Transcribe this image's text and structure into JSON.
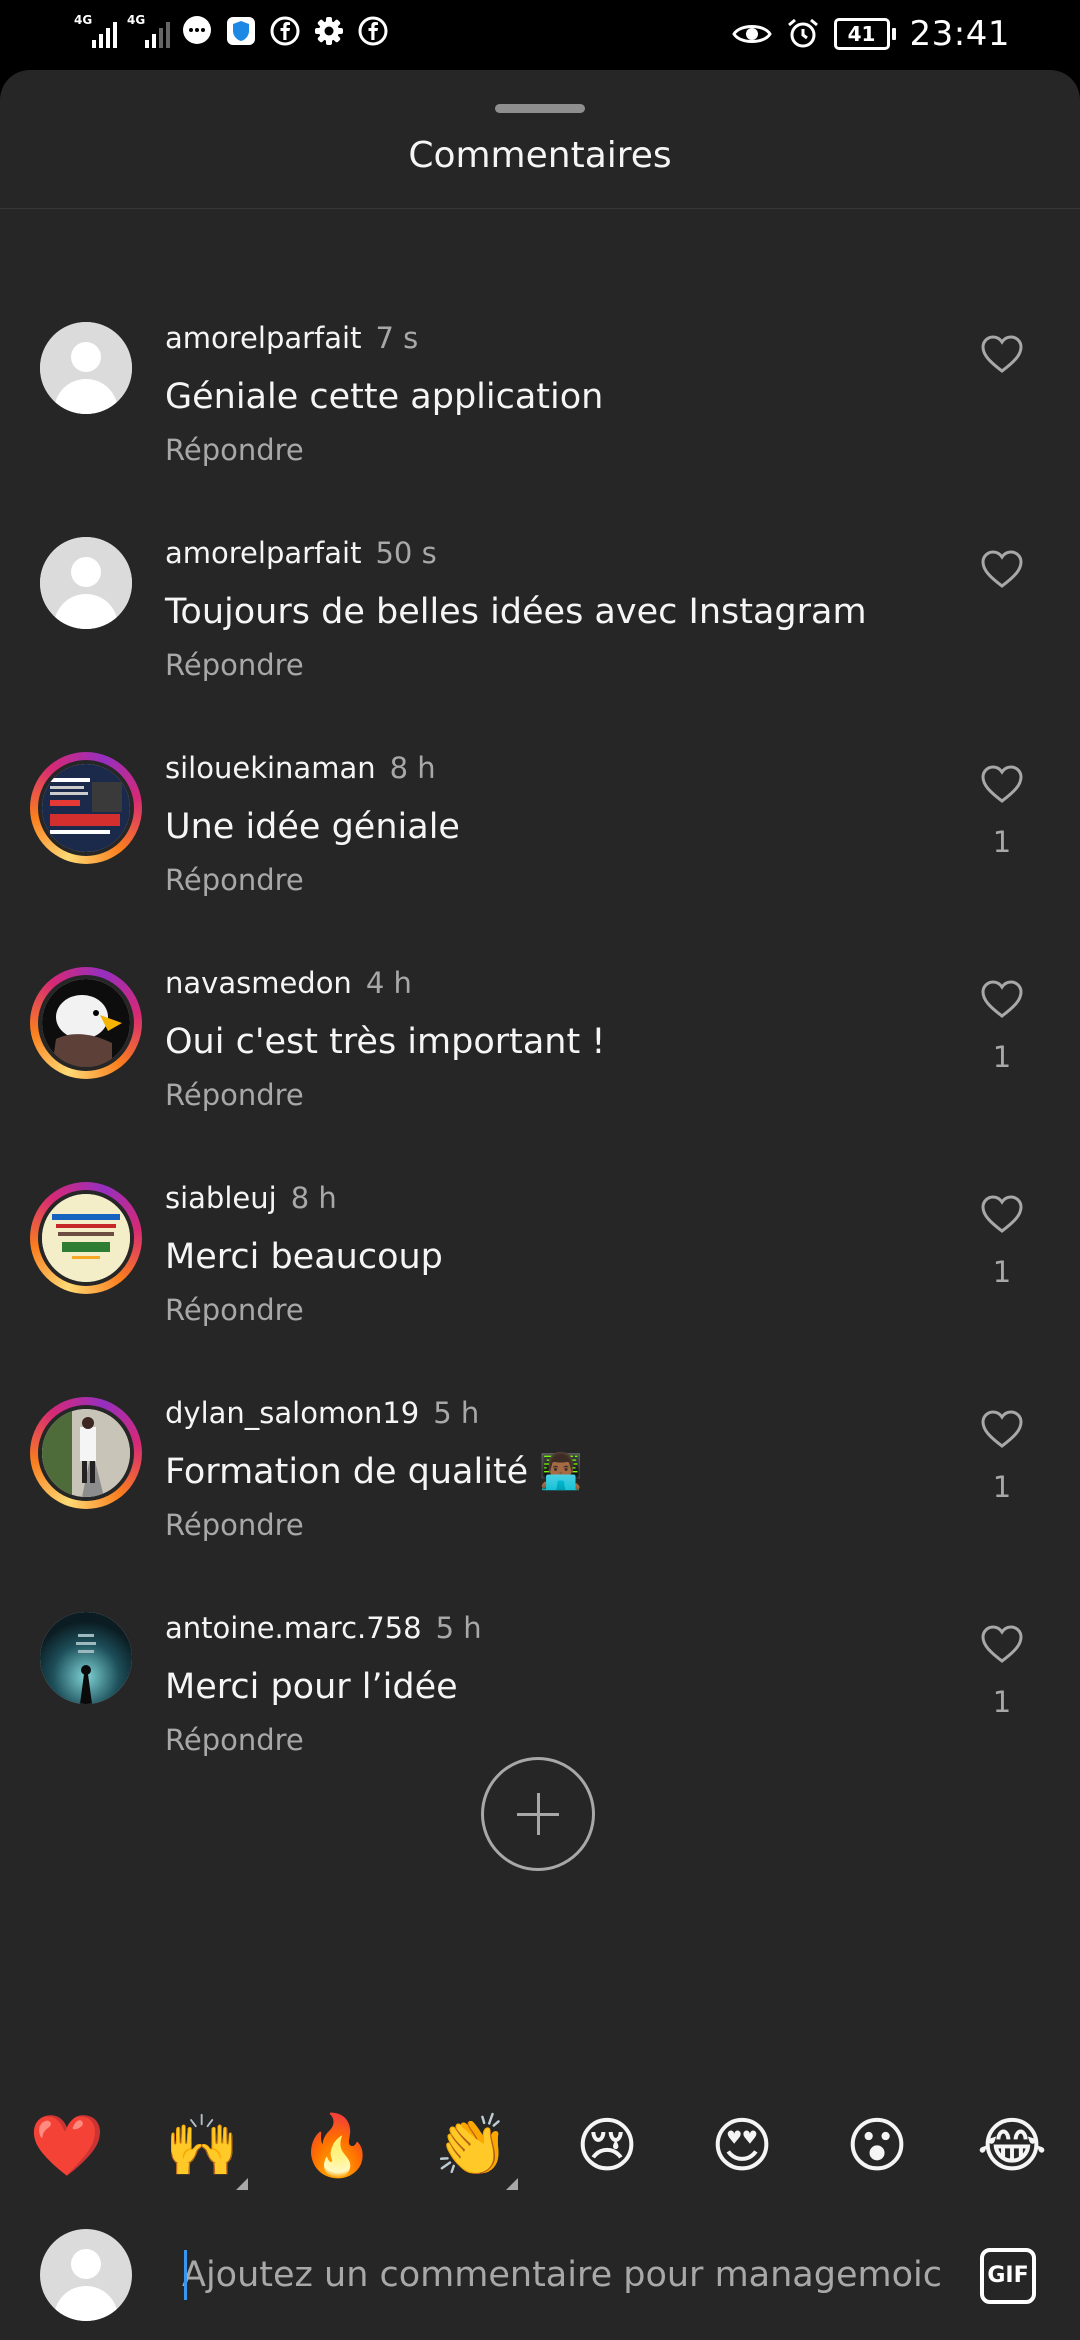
{
  "status_bar": {
    "network1": "4G",
    "network2": "4G",
    "battery": "41",
    "time": "23:41"
  },
  "header": {
    "title": "Commentaires"
  },
  "comments": [
    {
      "user": "amorelparfait",
      "time": "7 s",
      "text": "Géniale cette application",
      "reply": "Répondre",
      "likes": "",
      "avatar": "default"
    },
    {
      "user": "amorelparfait",
      "time": "50 s",
      "text": "Toujours de belles idées avec Instagram",
      "reply": "Répondre",
      "likes": "",
      "avatar": "default"
    },
    {
      "user": "silouekinaman",
      "time": "8 h",
      "text": "Une idée géniale",
      "reply": "Répondre",
      "likes": "1",
      "avatar": "story"
    },
    {
      "user": "navasmedon",
      "time": "4 h",
      "text": "Oui c'est très important !",
      "reply": "Répondre",
      "likes": "1",
      "avatar": "eagle"
    },
    {
      "user": "siableuj",
      "time": "8 h",
      "text": "Merci beaucoup",
      "reply": "Répondre",
      "likes": "1",
      "avatar": "poster"
    },
    {
      "user": "dylan_salomon19",
      "time": "5 h",
      "text": "Formation de qualité 👨🏾‍💻",
      "reply": "Répondre",
      "likes": "1",
      "avatar": "photo"
    },
    {
      "user": "antoine.marc.758",
      "time": "5 h",
      "text": "Merci pour l’idée",
      "reply": "Répondre",
      "likes": "1",
      "avatar": "dark"
    }
  ],
  "reactions": [
    "❤️",
    "🙌",
    "🔥",
    "👏",
    "😢",
    "😍",
    "😮",
    "😂"
  ],
  "composer": {
    "placeholder": "Ajoutez un commentaire pour managemoici...",
    "gif_label": "GIF"
  },
  "colors": {
    "background": "#262626",
    "text_primary": "#f5f5f5",
    "text_secondary": "#a8a8a8",
    "heart": "#a8a8a8"
  }
}
